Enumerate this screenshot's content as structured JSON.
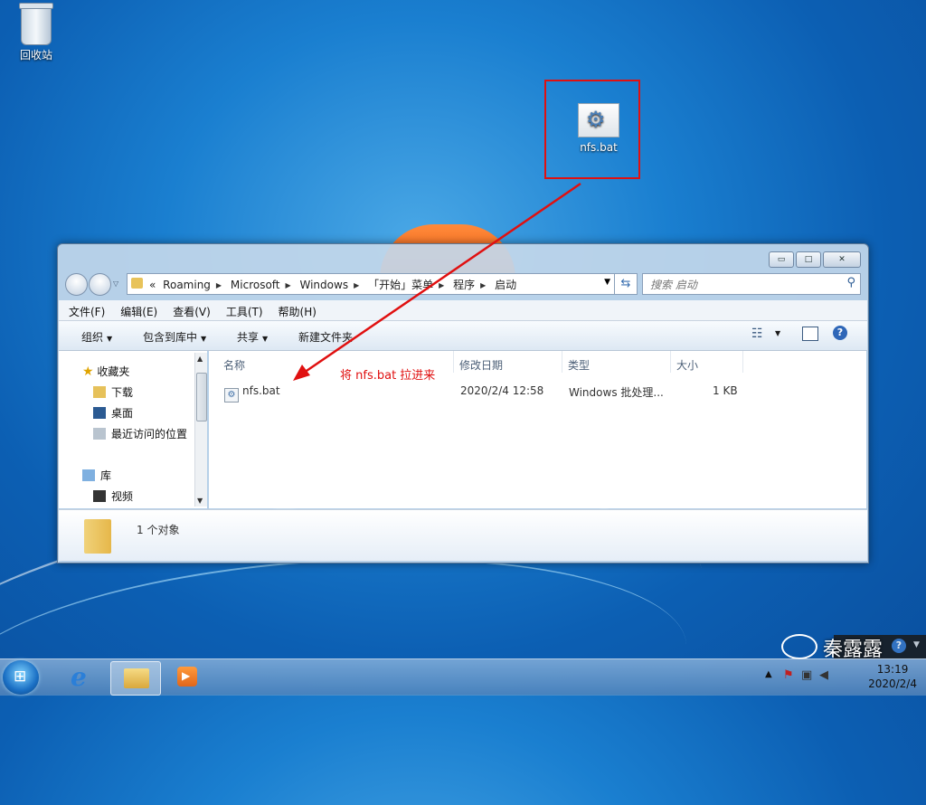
{
  "desktop": {
    "recycle_bin_label": "回收站",
    "bat_file_label": "nfs.bat",
    "watermark": "秦露露"
  },
  "window": {
    "caption_buttons": {
      "minimize": "▭",
      "maximize": "□",
      "close": "✕"
    },
    "address": {
      "prefix": "«",
      "crumbs": [
        "Roaming",
        "Microsoft",
        "Windows",
        "「开始」菜单",
        "程序",
        "启动"
      ]
    },
    "search_placeholder": "搜索 启动",
    "menu": [
      "文件(F)",
      "编辑(E)",
      "查看(V)",
      "工具(T)",
      "帮助(H)"
    ],
    "toolbar": {
      "organize": "组织",
      "include": "包含到库中",
      "share": "共享",
      "new_folder": "新建文件夹"
    },
    "nav": {
      "favorites": "收藏夹",
      "downloads": "下载",
      "desktop": "桌面",
      "recent": "最近访问的位置",
      "libraries": "库",
      "videos": "视频"
    },
    "columns": {
      "name": "名称",
      "date": "修改日期",
      "type": "类型",
      "size": "大小"
    },
    "files": [
      {
        "name": "nfs.bat",
        "date": "2020/2/4 12:58",
        "type": "Windows 批处理...",
        "size": "1 KB"
      }
    ],
    "annotation": "将 nfs.bat 拉进来",
    "status": "1 个对象"
  },
  "taskbar": {
    "clock_time": "13:19",
    "clock_date": "2020/2/4"
  },
  "colors": {
    "annotation_red": "#e01010",
    "desktop_blue": "#1a7fd0"
  }
}
